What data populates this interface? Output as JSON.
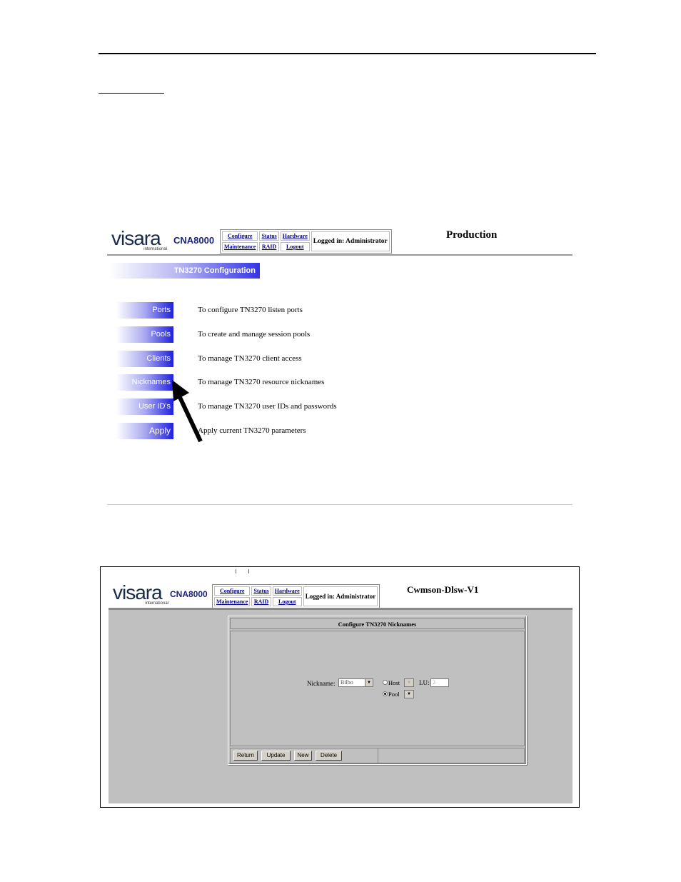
{
  "brand": {
    "logo_text": "visara",
    "logo_sub": "international"
  },
  "screen1": {
    "product": "CNA8000",
    "nav": {
      "configure": "Configure",
      "status": "Status",
      "hardware": "Hardware",
      "maintenance": "Maintenance",
      "raid": "RAID",
      "logout": "Logout",
      "logged_in": "Logged in: Administrator"
    },
    "site_name": "Production",
    "banner": "TN3270 Configuration",
    "menu": [
      {
        "label": "Ports",
        "desc": "To configure TN3270 listen ports"
      },
      {
        "label": "Pools",
        "desc": "To create and manage session pools"
      },
      {
        "label": "Clients",
        "desc": "To manage TN3270 client access"
      },
      {
        "label": "Nicknames",
        "desc": "To manage TN3270 resource nicknames"
      },
      {
        "label": "User ID's",
        "desc": "To manage TN3270 user IDs and passwords"
      },
      {
        "label": "Apply",
        "desc": "Apply current TN3270 parameters"
      }
    ]
  },
  "screen2": {
    "product": "CNA8000",
    "nav": {
      "configure": "Configure",
      "status": "Status",
      "hardware": "Hardware",
      "maintenance": "Maintenance",
      "raid": "RAID",
      "logout": "Logout",
      "logged_in": "Logged in: Administrator"
    },
    "site_name": "Cwmson-Dlsw-V1",
    "panel_title": "Configure TN3270 Nicknames",
    "form": {
      "nickname_label": "Nickname:",
      "nickname_value": "Bilbo",
      "host_label": "Host",
      "pool_label": "Pool",
      "lu_label": "LU:",
      "lu_value": "2",
      "selected": "Pool"
    },
    "buttons": {
      "return": "Return",
      "update": "Update",
      "new": "New",
      "delete": "Delete"
    }
  }
}
